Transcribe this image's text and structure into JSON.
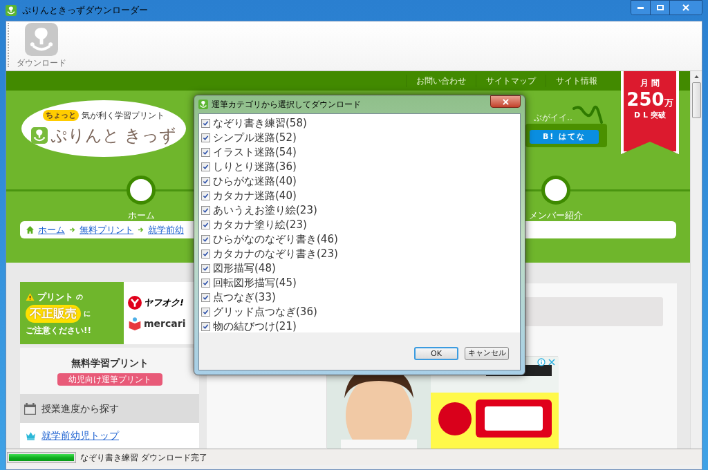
{
  "window": {
    "title": "ぷりんときっずダウンローダー"
  },
  "toolbar": {
    "items": [
      {
        "label": "ダウンロード"
      }
    ]
  },
  "site": {
    "top_links": [
      "お問い合わせ",
      "サイトマップ",
      "サイト情報"
    ],
    "logo": {
      "badge": "ちょっと",
      "tagline": "気が利く学習プリント",
      "name": "ぷりんと きっず"
    },
    "teaser": "ぶがイイ‥",
    "share_button": "B! はてな",
    "ribbon": {
      "top": "月 間",
      "number": "250",
      "unit": "万",
      "bottom": "D L 突破"
    },
    "nav": [
      {
        "label": "ホーム"
      },
      {
        "label": "メンバー紹介"
      }
    ],
    "breadcrumb": [
      "ホーム",
      "無料プリント",
      "就学前幼"
    ],
    "notice": {
      "line1": "プリント",
      "line1_tail": "の",
      "highlight": "不正販売",
      "highlight_tail": "に",
      "line3": "ご注意ください!!",
      "brands": [
        "ヤフオク!",
        "mercari"
      ]
    },
    "sidebar": {
      "title": "無料学習プリント",
      "tag": "幼児向け運筆プリント",
      "items": [
        {
          "kind": "header",
          "label": "授業進度から探す"
        },
        {
          "kind": "link",
          "label": "就学前幼児トップ"
        }
      ]
    }
  },
  "dialog": {
    "title": "運筆カテゴリから選択してダウンロード",
    "categories": [
      {
        "label": "なぞり書き練習(58)",
        "checked": true
      },
      {
        "label": "シンプル迷路(52)",
        "checked": true
      },
      {
        "label": "イラスト迷路(54)",
        "checked": true
      },
      {
        "label": "しりとり迷路(36)",
        "checked": true
      },
      {
        "label": "ひらがな迷路(40)",
        "checked": true
      },
      {
        "label": "カタカナ迷路(40)",
        "checked": true
      },
      {
        "label": "あいうえお塗り絵(23)",
        "checked": true
      },
      {
        "label": "カタカナ塗り絵(23)",
        "checked": true
      },
      {
        "label": "ひらがなのなぞり書き(46)",
        "checked": true
      },
      {
        "label": "カタカナのなぞり書き(23)",
        "checked": true
      },
      {
        "label": "図形描写(48)",
        "checked": true
      },
      {
        "label": "回転図形描写(45)",
        "checked": true
      },
      {
        "label": "点つなぎ(33)",
        "checked": true
      },
      {
        "label": "グリッド点つなぎ(36)",
        "checked": true
      },
      {
        "label": "物の結びつけ(21)",
        "checked": true
      }
    ],
    "buttons": [
      "OK",
      "キャンセル"
    ]
  },
  "status_bar": {
    "level": 1,
    "text": "なぞり書き練習 ダウンロード完了"
  }
}
